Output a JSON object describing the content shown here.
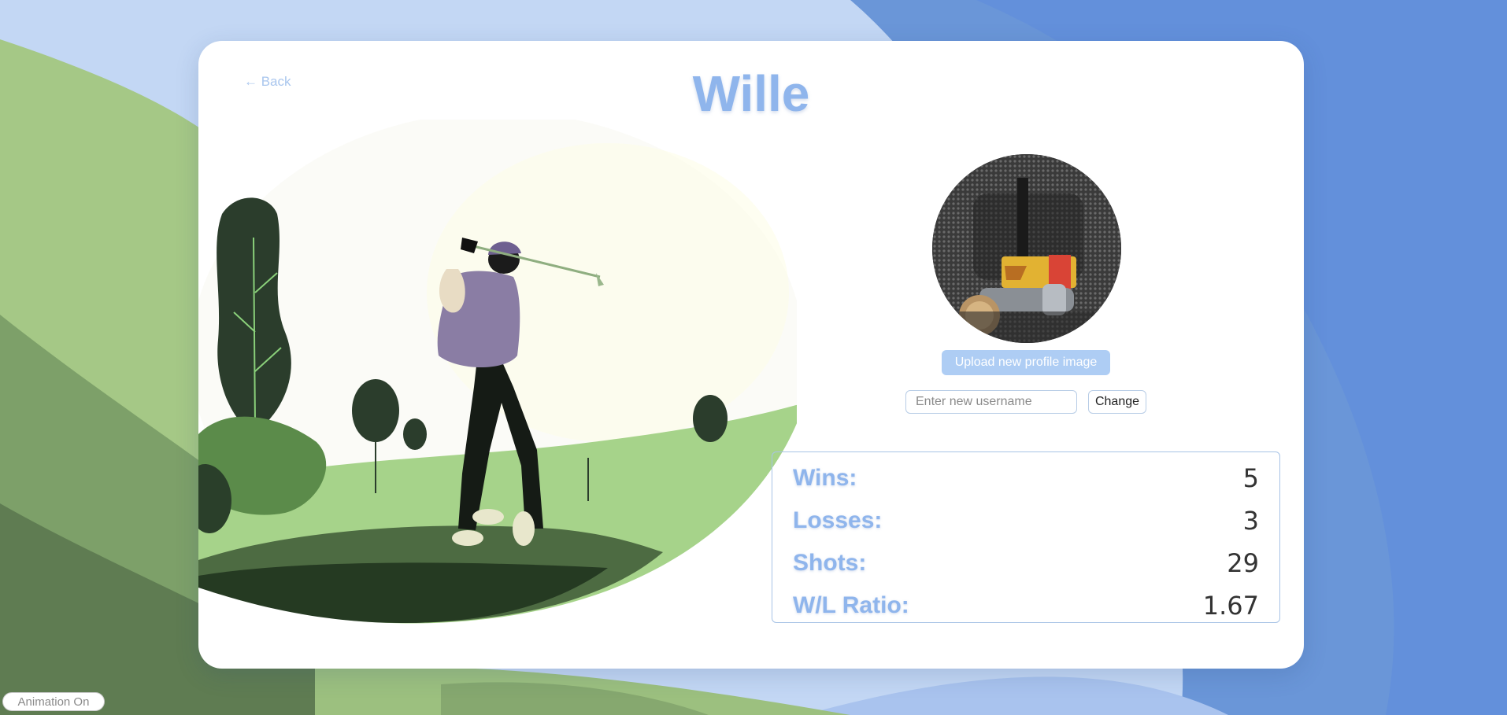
{
  "nav": {
    "back_label": "← Back"
  },
  "profile": {
    "username": "Wille",
    "upload_button_label": "Upload new profile image",
    "username_input_placeholder": "Enter new username",
    "change_button_label": "Change"
  },
  "stats": [
    {
      "label": "Wins:",
      "value": "5"
    },
    {
      "label": "Losses:",
      "value": "3"
    },
    {
      "label": "Shots:",
      "value": "29"
    },
    {
      "label": "W/L Ratio:",
      "value": "1.67"
    }
  ],
  "footer": {
    "animation_toggle_label": "Animation On"
  },
  "colors": {
    "accent": "#8fb5ec",
    "background_blue": "#6a96d8",
    "background_green": "#a5c886",
    "card": "#ffffff"
  }
}
